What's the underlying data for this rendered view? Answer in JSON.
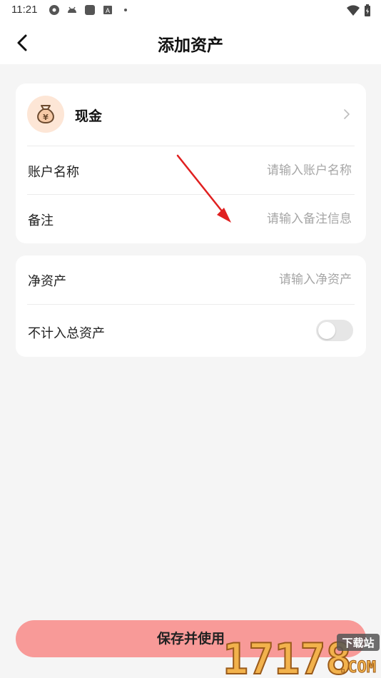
{
  "status_bar": {
    "time": "11:21"
  },
  "header": {
    "title": "添加资产"
  },
  "account_type": {
    "label": "现金",
    "icon": "money-bag-icon"
  },
  "fields": {
    "account_name": {
      "label": "账户名称",
      "placeholder": "请输入账户名称",
      "value": ""
    },
    "remark": {
      "label": "备注",
      "placeholder": "请输入备注信息",
      "value": ""
    },
    "net_asset": {
      "label": "净资产",
      "placeholder": "请输入净资产",
      "value": ""
    }
  },
  "exclude_total": {
    "label": "不计入总资产",
    "enabled": false
  },
  "save_button": {
    "label": "保存并使用"
  },
  "watermark": {
    "number": "17178",
    "domain": ".COM",
    "tag": "下载站"
  },
  "colors": {
    "accent": "#f89a98",
    "background": "#f5f5f5",
    "avatar_bg": "#fde6d6",
    "toggle_off": "#e6e6e6",
    "annotation": "#e02020"
  }
}
